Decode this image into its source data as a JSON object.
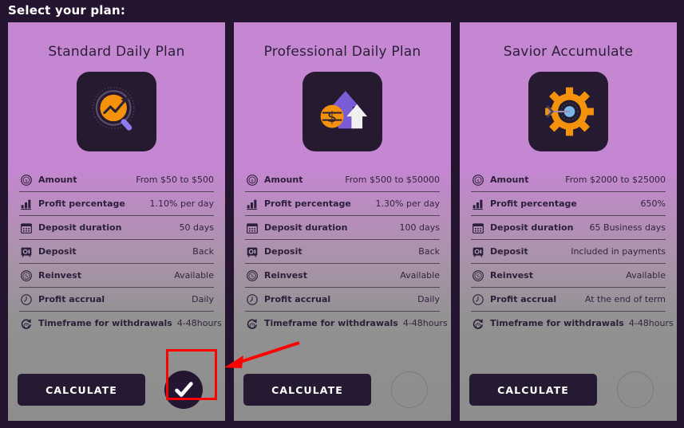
{
  "header": {
    "title": "Select your plan:"
  },
  "colors": {
    "page_background": "#241430",
    "card_top": "#c586d2",
    "card_bottom": "#8d8d8d",
    "button": "#261a33",
    "accent_orange": "#f5920b",
    "annotation_red": "#ff0000",
    "label_text": "#2b1f3a"
  },
  "row_labels": {
    "amount": "Amount",
    "profit_percentage": "Profit percentage",
    "deposit_duration": "Deposit duration",
    "deposit": "Deposit",
    "reinvest": "Reinvest",
    "profit_accrual": "Profit accrual",
    "timeframe": "Timeframe for withdrawals"
  },
  "row_icons": {
    "amount": "dollar-coin-icon",
    "profit_percentage": "bar-chart-icon",
    "deposit_duration": "calendar-icon",
    "deposit": "safe-vault-icon",
    "reinvest": "percent-circle-icon",
    "profit_accrual": "clock-icon",
    "timeframe": "history-refresh-icon"
  },
  "cards": [
    {
      "id": "standard-daily-plan",
      "title": "Standard Daily Plan",
      "icon": "magnifier-chart-icon",
      "calculate_label": "CALCULATE",
      "selected": true,
      "rows": [
        {
          "label": "Amount",
          "value": "From $50 to $500",
          "icon": "dollar-coin-icon"
        },
        {
          "label": "Profit percentage",
          "value": "1.10% per day",
          "icon": "bar-chart-icon"
        },
        {
          "label": "Deposit duration",
          "value": "50 days",
          "icon": "calendar-icon"
        },
        {
          "label": "Deposit",
          "value": "Back",
          "icon": "safe-vault-icon"
        },
        {
          "label": "Reinvest",
          "value": "Available",
          "icon": "percent-circle-icon"
        },
        {
          "label": "Profit accrual",
          "value": "Daily",
          "icon": "clock-icon"
        },
        {
          "label": "Timeframe for withdrawals",
          "value": "4-48hours",
          "icon": "history-refresh-icon"
        }
      ]
    },
    {
      "id": "professional-daily-plan",
      "title": "Professional Daily Plan",
      "icon": "arrows-dollar-icon",
      "calculate_label": "CALCULATE",
      "selected": false,
      "rows": [
        {
          "label": "Amount",
          "value": "From $500 to $50000",
          "icon": "dollar-coin-icon"
        },
        {
          "label": "Profit percentage",
          "value": "1.30% per day",
          "icon": "bar-chart-icon"
        },
        {
          "label": "Deposit duration",
          "value": "100 days",
          "icon": "calendar-icon"
        },
        {
          "label": "Deposit",
          "value": "Back",
          "icon": "safe-vault-icon"
        },
        {
          "label": "Reinvest",
          "value": "Available",
          "icon": "percent-circle-icon"
        },
        {
          "label": "Profit accrual",
          "value": "Daily",
          "icon": "clock-icon"
        },
        {
          "label": "Timeframe for withdrawals",
          "value": "4-48hours",
          "icon": "history-refresh-icon"
        }
      ]
    },
    {
      "id": "savior-accumulate",
      "title": "Savior Accumulate",
      "icon": "gear-target-icon",
      "calculate_label": "CALCULATE",
      "selected": false,
      "rows": [
        {
          "label": "Amount",
          "value": "From $2000 to $25000",
          "icon": "dollar-coin-icon"
        },
        {
          "label": "Profit percentage",
          "value": "650%",
          "icon": "bar-chart-icon"
        },
        {
          "label": "Deposit duration",
          "value": "65 Business days",
          "icon": "calendar-icon"
        },
        {
          "label": "Deposit",
          "value": "Included in payments",
          "icon": "safe-vault-icon"
        },
        {
          "label": "Reinvest",
          "value": "Available",
          "icon": "percent-circle-icon"
        },
        {
          "label": "Profit accrual",
          "value": "At the end of term",
          "icon": "clock-icon"
        },
        {
          "label": "Timeframe for withdrawals",
          "value": "4-48hours",
          "icon": "history-refresh-icon"
        }
      ]
    }
  ],
  "annotation": {
    "highlight_target": "standard-plan-select-radio",
    "shape": "red-rectangle-with-arrow"
  }
}
